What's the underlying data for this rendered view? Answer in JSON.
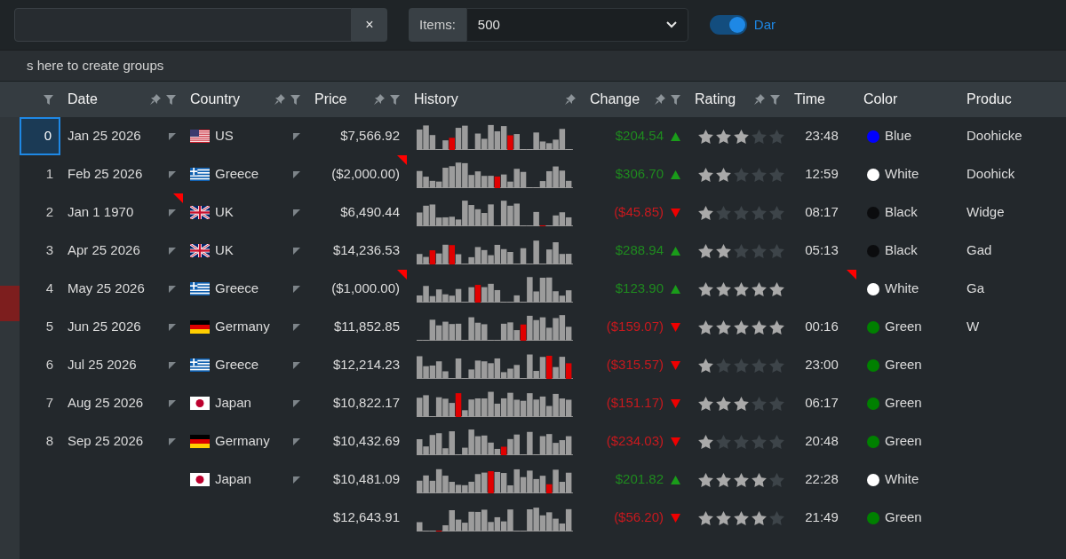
{
  "toolbar": {
    "search": {
      "clear_button": "×"
    },
    "items": {
      "label": "Items:",
      "value": "500",
      "expanded": false
    },
    "toggle": {
      "label": "Dar",
      "on": true
    }
  },
  "group_panel": {
    "hint": "s here to create groups"
  },
  "columns": [
    {
      "pin": false,
      "filter": true
    },
    {
      "label": "Date",
      "pin": true,
      "filter": true
    },
    {
      "label": "Country",
      "pin": true,
      "filter": true
    },
    {
      "label": "Price",
      "pin": true,
      "filter": true
    },
    {
      "label": "History",
      "pin": true,
      "filter": false
    },
    {
      "label": "Change",
      "pin": true,
      "filter": true
    },
    {
      "label": "Rating",
      "pin": true,
      "filter": true
    },
    {
      "label": "Time",
      "pin": false,
      "filter": false
    },
    {
      "label": "Color",
      "pin": false,
      "filter": false
    },
    {
      "label": "Produc",
      "pin": false,
      "filter": false
    }
  ],
  "rows": [
    {
      "index": "0",
      "selected": true,
      "date": "Jan 25 2026",
      "date_flagged": false,
      "country": {
        "kind": "us",
        "name": "US"
      },
      "price": "$7,566.92",
      "price_flagged": false,
      "change": "$204.54",
      "rising": true,
      "stars": 3,
      "time": "23:48",
      "time_flagged": false,
      "color_name": "Blue",
      "color": "#0000ff",
      "product": "Doohicke"
    },
    {
      "index": "1",
      "selected": false,
      "date": "Feb 25 2026",
      "date_flagged": false,
      "country": {
        "kind": "gr",
        "name": "Greece"
      },
      "price": "($2,000.00)",
      "price_flagged": true,
      "change": "$306.70",
      "rising": true,
      "stars": 2,
      "time": "12:59",
      "time_flagged": false,
      "color_name": "White",
      "color": "#ffffff",
      "product": "Doohick"
    },
    {
      "index": "2",
      "selected": false,
      "date": "Jan 1 1970",
      "date_flagged": true,
      "country": {
        "kind": "uk",
        "name": "UK"
      },
      "price": "$6,490.44",
      "price_flagged": false,
      "change": "($45.85)",
      "rising": false,
      "stars": 1,
      "time": "08:17",
      "time_flagged": false,
      "color_name": "Black",
      "color": "#0b0c0e",
      "product": "Widge"
    },
    {
      "index": "3",
      "selected": false,
      "date": "Apr 25 2026",
      "date_flagged": false,
      "country": {
        "kind": "uk",
        "name": "UK"
      },
      "price": "$14,236.53",
      "price_flagged": false,
      "change": "$288.94",
      "rising": true,
      "stars": 2,
      "time": "05:13",
      "time_flagged": false,
      "color_name": "Black",
      "color": "#0b0c0e",
      "product": "Gad"
    },
    {
      "index": "4",
      "selected": false,
      "date": "May 25 2026",
      "date_flagged": false,
      "country": {
        "kind": "gr",
        "name": "Greece"
      },
      "price": "($1,000.00)",
      "price_flagged": true,
      "change": "$123.90",
      "rising": true,
      "stars": 5,
      "time_flagged": true,
      "color_name": "White",
      "color": "#ffffff",
      "product": "Ga"
    },
    {
      "index": "5",
      "selected": false,
      "date": "Jun 25 2026",
      "date_flagged": false,
      "country": {
        "kind": "de",
        "name": "Germany"
      },
      "price": "$11,852.85",
      "price_flagged": false,
      "change": "($159.07)",
      "rising": false,
      "stars": 5,
      "time": "00:16",
      "time_flagged": false,
      "color_name": "Green",
      "color": "#008000",
      "product": "W"
    },
    {
      "index": "6",
      "selected": false,
      "date": "Jul 25 2026",
      "date_flagged": false,
      "country": {
        "kind": "gr",
        "name": "Greece"
      },
      "price": "$12,214.23",
      "price_flagged": false,
      "change": "($315.57)",
      "rising": false,
      "stars": 1,
      "time": "23:00",
      "time_flagged": false,
      "color_name": "Green",
      "color": "#008000"
    },
    {
      "index": "7",
      "selected": false,
      "date": "Aug 25 2026",
      "date_flagged": false,
      "country": {
        "kind": "jp",
        "name": "Japan"
      },
      "price": "$10,822.17",
      "price_flagged": false,
      "change": "($151.17)",
      "rising": false,
      "stars": 3,
      "time": "06:17",
      "time_flagged": false,
      "color_name": "Green",
      "color": "#008000"
    },
    {
      "index": "8",
      "selected": false,
      "date": "Sep 25 2026",
      "date_flagged": false,
      "country": {
        "kind": "de",
        "name": "Germany"
      },
      "price": "$10,432.69",
      "price_flagged": false,
      "change": "($234.03)",
      "rising": false,
      "stars": 1,
      "time": "20:48",
      "time_flagged": false,
      "color_name": "Green",
      "color": "#008000"
    },
    {
      "selected": false,
      "country": {
        "kind": "jp",
        "name": "Japan"
      },
      "price": "$10,481.09",
      "price_flagged": false,
      "change": "$201.82",
      "rising": true,
      "stars": 4,
      "time": "22:28",
      "time_flagged": false,
      "color_name": "White",
      "color": "#ffffff"
    },
    {
      "selected": false,
      "price": "$12,643.91",
      "price_flagged": false,
      "change": "($56.20)",
      "rising": false,
      "stars": 4,
      "time": "21:49",
      "time_flagged": false,
      "color_name": "Green",
      "color": "#008000"
    }
  ]
}
